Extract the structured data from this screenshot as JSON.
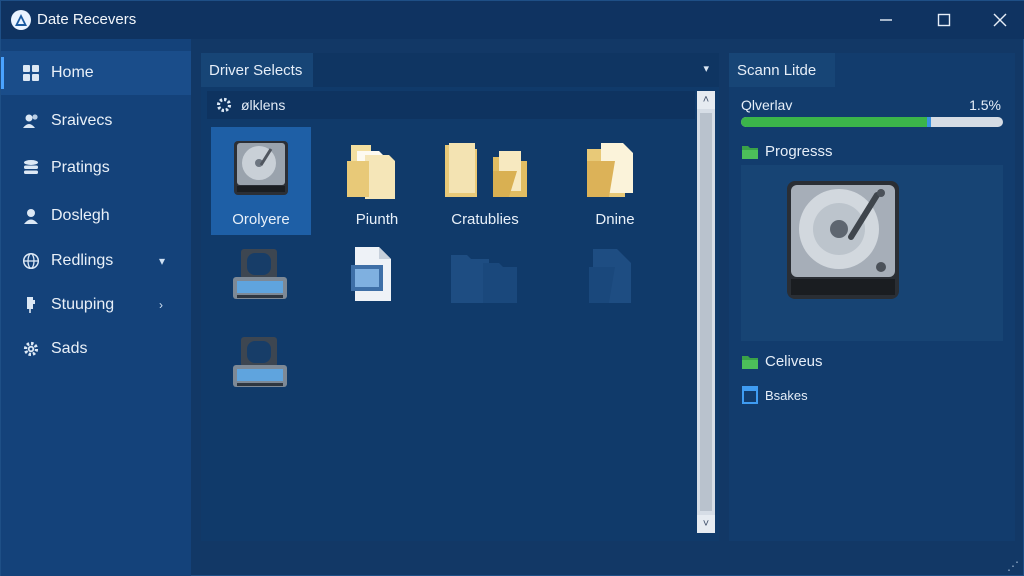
{
  "window": {
    "title": "Date Recevers",
    "controls": {
      "minimize": "—",
      "maximize": "☐",
      "close": "✕"
    }
  },
  "sidebar": {
    "items": [
      {
        "label": "Home",
        "icon": "grid-icon",
        "active": true
      },
      {
        "label": "Sraivecs",
        "icon": "users-icon"
      },
      {
        "label": "Pratings",
        "icon": "database-icon"
      },
      {
        "label": "Doslegh",
        "icon": "user-icon"
      },
      {
        "label": "Redlings",
        "icon": "globe-icon",
        "chevron": "▾"
      },
      {
        "label": "Stuuping",
        "icon": "pin-icon",
        "chevron": "›"
      },
      {
        "label": "Sads",
        "icon": "gear-icon"
      }
    ]
  },
  "main": {
    "tab_label": "Driver Selects",
    "dropdown_arrow": "▾",
    "subbar_label": "ølklens",
    "tiles": [
      {
        "label": "Orolyere",
        "icon": "hard-drive-icon",
        "selected": true
      },
      {
        "label": "Piunth",
        "icon": "folder-documents-icon"
      },
      {
        "label": "Cratublies",
        "icon": "folders-icon"
      },
      {
        "label": "Dnine",
        "icon": "folder-file-icon"
      },
      {
        "label": "",
        "icon": "removable-drive-icon"
      },
      {
        "label": "",
        "icon": "media-file-icon"
      },
      {
        "label": "",
        "icon": "faded-folder-icon"
      },
      {
        "label": "",
        "icon": "faded-file-icon"
      },
      {
        "label": "",
        "icon": "removable-drive-icon"
      }
    ],
    "scroll": {
      "up": "˄",
      "down": "˅"
    }
  },
  "right": {
    "tab_label": "Scann Litde",
    "overview_label": "Qlverlav",
    "overview_percent": "1.5%",
    "progress_fraction": 0.71,
    "rows": [
      {
        "label": "Progresss",
        "icon": "green-folder-icon"
      },
      {
        "label": "Celiveus",
        "icon": "green-folder-icon"
      },
      {
        "label": "Bsakes",
        "icon": "blue-file-icon"
      }
    ]
  },
  "colors": {
    "accent": "#4aa3ff",
    "progress": "#3bb54a",
    "selection": "#1e5fa6",
    "background": "#123866"
  },
  "resize_grip": "⋰"
}
